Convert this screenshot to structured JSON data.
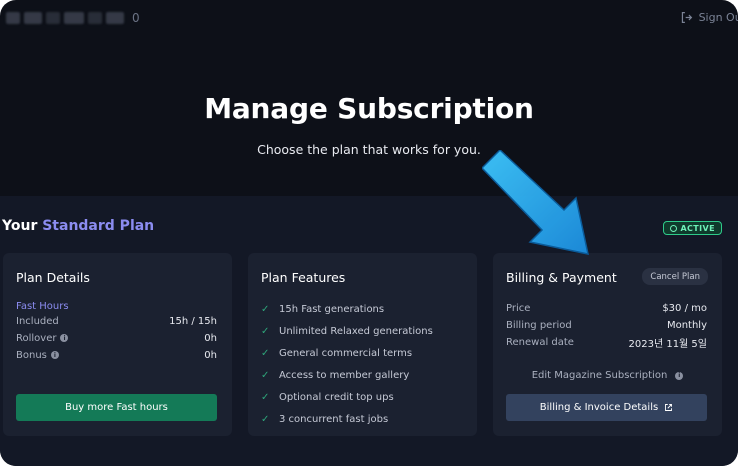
{
  "header": {
    "account_suffix": "0",
    "signout_label": "Sign Out",
    "signout_icon": "sign-out-icon"
  },
  "hero": {
    "title": "Manage Subscription",
    "subtitle": "Choose the plan that works for you."
  },
  "plan": {
    "prefix": "Your ",
    "name": "Standard Plan",
    "status": "ACTIVE",
    "status_color": "#2ecb8a"
  },
  "plan_details": {
    "title": "Plan Details",
    "fast_hours_label": "Fast Hours",
    "rows": [
      {
        "label": "Included",
        "value": "15h / 15h",
        "info": false
      },
      {
        "label": "Rollover",
        "value": "0h",
        "info": true
      },
      {
        "label": "Bonus",
        "value": "0h",
        "info": true
      }
    ],
    "buy_button": "Buy more Fast hours",
    "buy_button_color": "#147a57"
  },
  "plan_features": {
    "title": "Plan Features",
    "items": [
      "15h Fast generations",
      "Unlimited Relaxed generations",
      "General commercial terms",
      "Access to member gallery",
      "Optional credit top ups",
      "3 concurrent fast jobs"
    ]
  },
  "billing": {
    "title": "Billing & Payment",
    "cancel_button": "Cancel Plan",
    "rows": [
      {
        "label": "Price",
        "value": "$30 / mo"
      },
      {
        "label": "Billing period",
        "value": "Monthly"
      },
      {
        "label": "Renewal date",
        "value": "2023년 11월 5일"
      }
    ],
    "magazine_link": "Edit Magazine Subscription",
    "invoice_button": "Billing & Invoice Details",
    "accent_color": "#8b8cf0"
  }
}
